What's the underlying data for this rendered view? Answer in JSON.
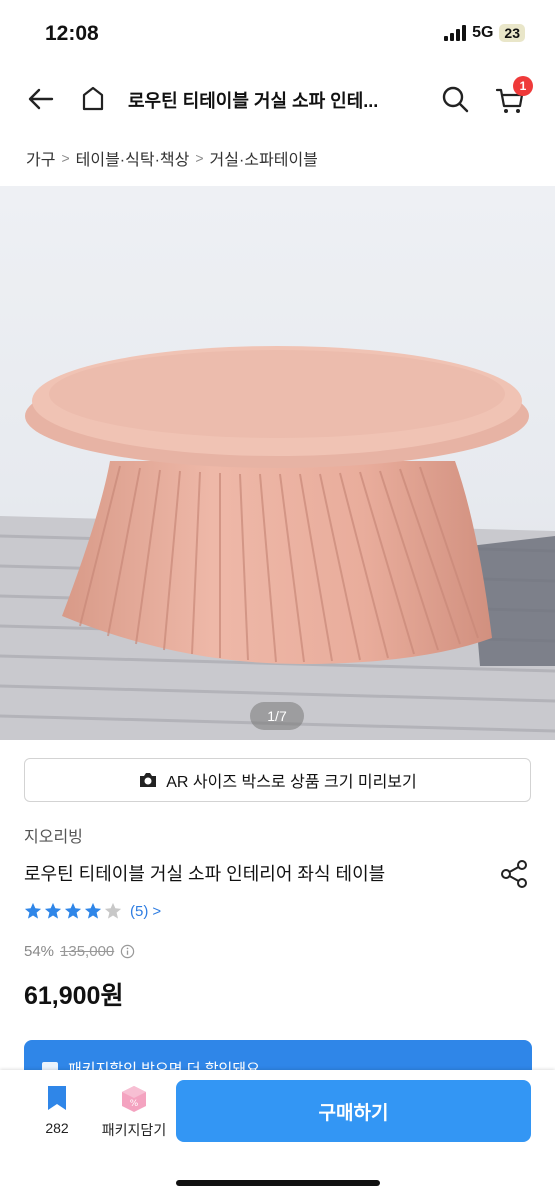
{
  "status_bar": {
    "time": "12:08",
    "network": "5G",
    "battery": "23"
  },
  "header": {
    "title": "로우틴 티테이블 거실 소파 인테...",
    "cart_badge": "1"
  },
  "breadcrumb": [
    "가구",
    "테이블·식탁·책상",
    "거실·소파테이블"
  ],
  "image": {
    "page_indicator": "1/7"
  },
  "ar_button": {
    "label": "AR 사이즈 박스로 상품 크기 미리보기"
  },
  "product": {
    "brand": "지오리빙",
    "name": "로우틴 티테이블 거실 소파 인테리어 좌식 테이블",
    "rating": 4,
    "review_count": "(5)",
    "discount": "54%",
    "original_price": "135,000",
    "price": "61,900원"
  },
  "banner": {
    "text": "패키지할인 받으면 더 할인돼요"
  },
  "bottom_bar": {
    "bookmark_count": "282",
    "package_label": "패키지담기",
    "buy_label": "구매하기"
  },
  "colors": {
    "accent": "#3396f4",
    "badge": "#ef3a3a",
    "link": "#2f7de1",
    "table": "#e8b5a6"
  }
}
